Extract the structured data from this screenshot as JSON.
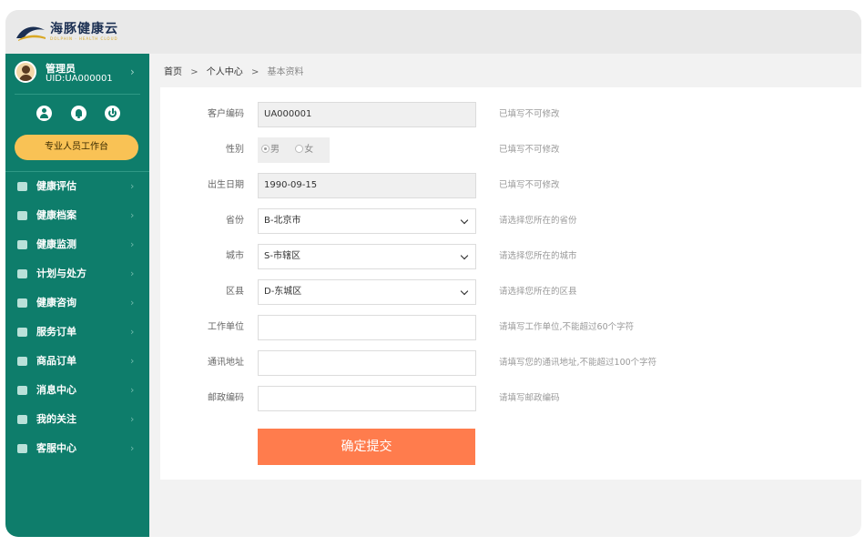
{
  "brand": {
    "name": "海豚健康云",
    "tagline": "DOLPHIN · HEALTH CLOUD"
  },
  "user": {
    "name": "管理员",
    "uid": "UID:UA000001"
  },
  "quick_actions": [
    {
      "icon": "user-icon"
    },
    {
      "icon": "bell-icon"
    },
    {
      "icon": "power-icon"
    }
  ],
  "workbench_button": "专业人员工作台",
  "menu": [
    {
      "label": "健康评估",
      "icon": "assessment-icon"
    },
    {
      "label": "健康档案",
      "icon": "archive-icon"
    },
    {
      "label": "健康监测",
      "icon": "database-icon"
    },
    {
      "label": "计划与处方",
      "icon": "folder-icon"
    },
    {
      "label": "健康咨询",
      "icon": "mail-icon"
    },
    {
      "label": "服务订单",
      "icon": "list-icon"
    },
    {
      "label": "商品订单",
      "icon": "cart-icon"
    },
    {
      "label": "消息中心",
      "icon": "message-icon"
    },
    {
      "label": "我的关注",
      "icon": "heart-icon"
    },
    {
      "label": "客服中心",
      "icon": "phone-icon"
    }
  ],
  "breadcrumb": {
    "home": "首页",
    "level1": "个人中心",
    "current": "基本资料",
    "sep": ">"
  },
  "form": {
    "customer_code": {
      "label": "客户编码",
      "value": "UA000001",
      "hint": "已填写不可修改"
    },
    "gender": {
      "label": "性别",
      "option1": "男",
      "option2": "女",
      "selected": "男",
      "hint": "已填写不可修改"
    },
    "birth_date": {
      "label": "出生日期",
      "value": "1990-09-15",
      "hint": "已填写不可修改"
    },
    "province": {
      "label": "省份",
      "value": "B-北京市",
      "hint": "请选择您所在的省份"
    },
    "city": {
      "label": "城市",
      "value": "S-市辖区",
      "hint": "请选择您所在的城市"
    },
    "district": {
      "label": "区县",
      "value": "D-东城区",
      "hint": "请选择您所在的区县"
    },
    "work_unit": {
      "label": "工作单位",
      "value": "",
      "hint": "请填写工作单位,不能超过60个字符"
    },
    "address": {
      "label": "通讯地址",
      "value": "",
      "hint": "请填写您的通讯地址,不能超过100个字符"
    },
    "postcode": {
      "label": "邮政编码",
      "value": "",
      "hint": "请填写邮政编码"
    },
    "submit": "确定提交"
  },
  "colors": {
    "sidebar": "#0e7d6b",
    "accent": "#ff7c4d",
    "workbench": "#f9c255"
  }
}
